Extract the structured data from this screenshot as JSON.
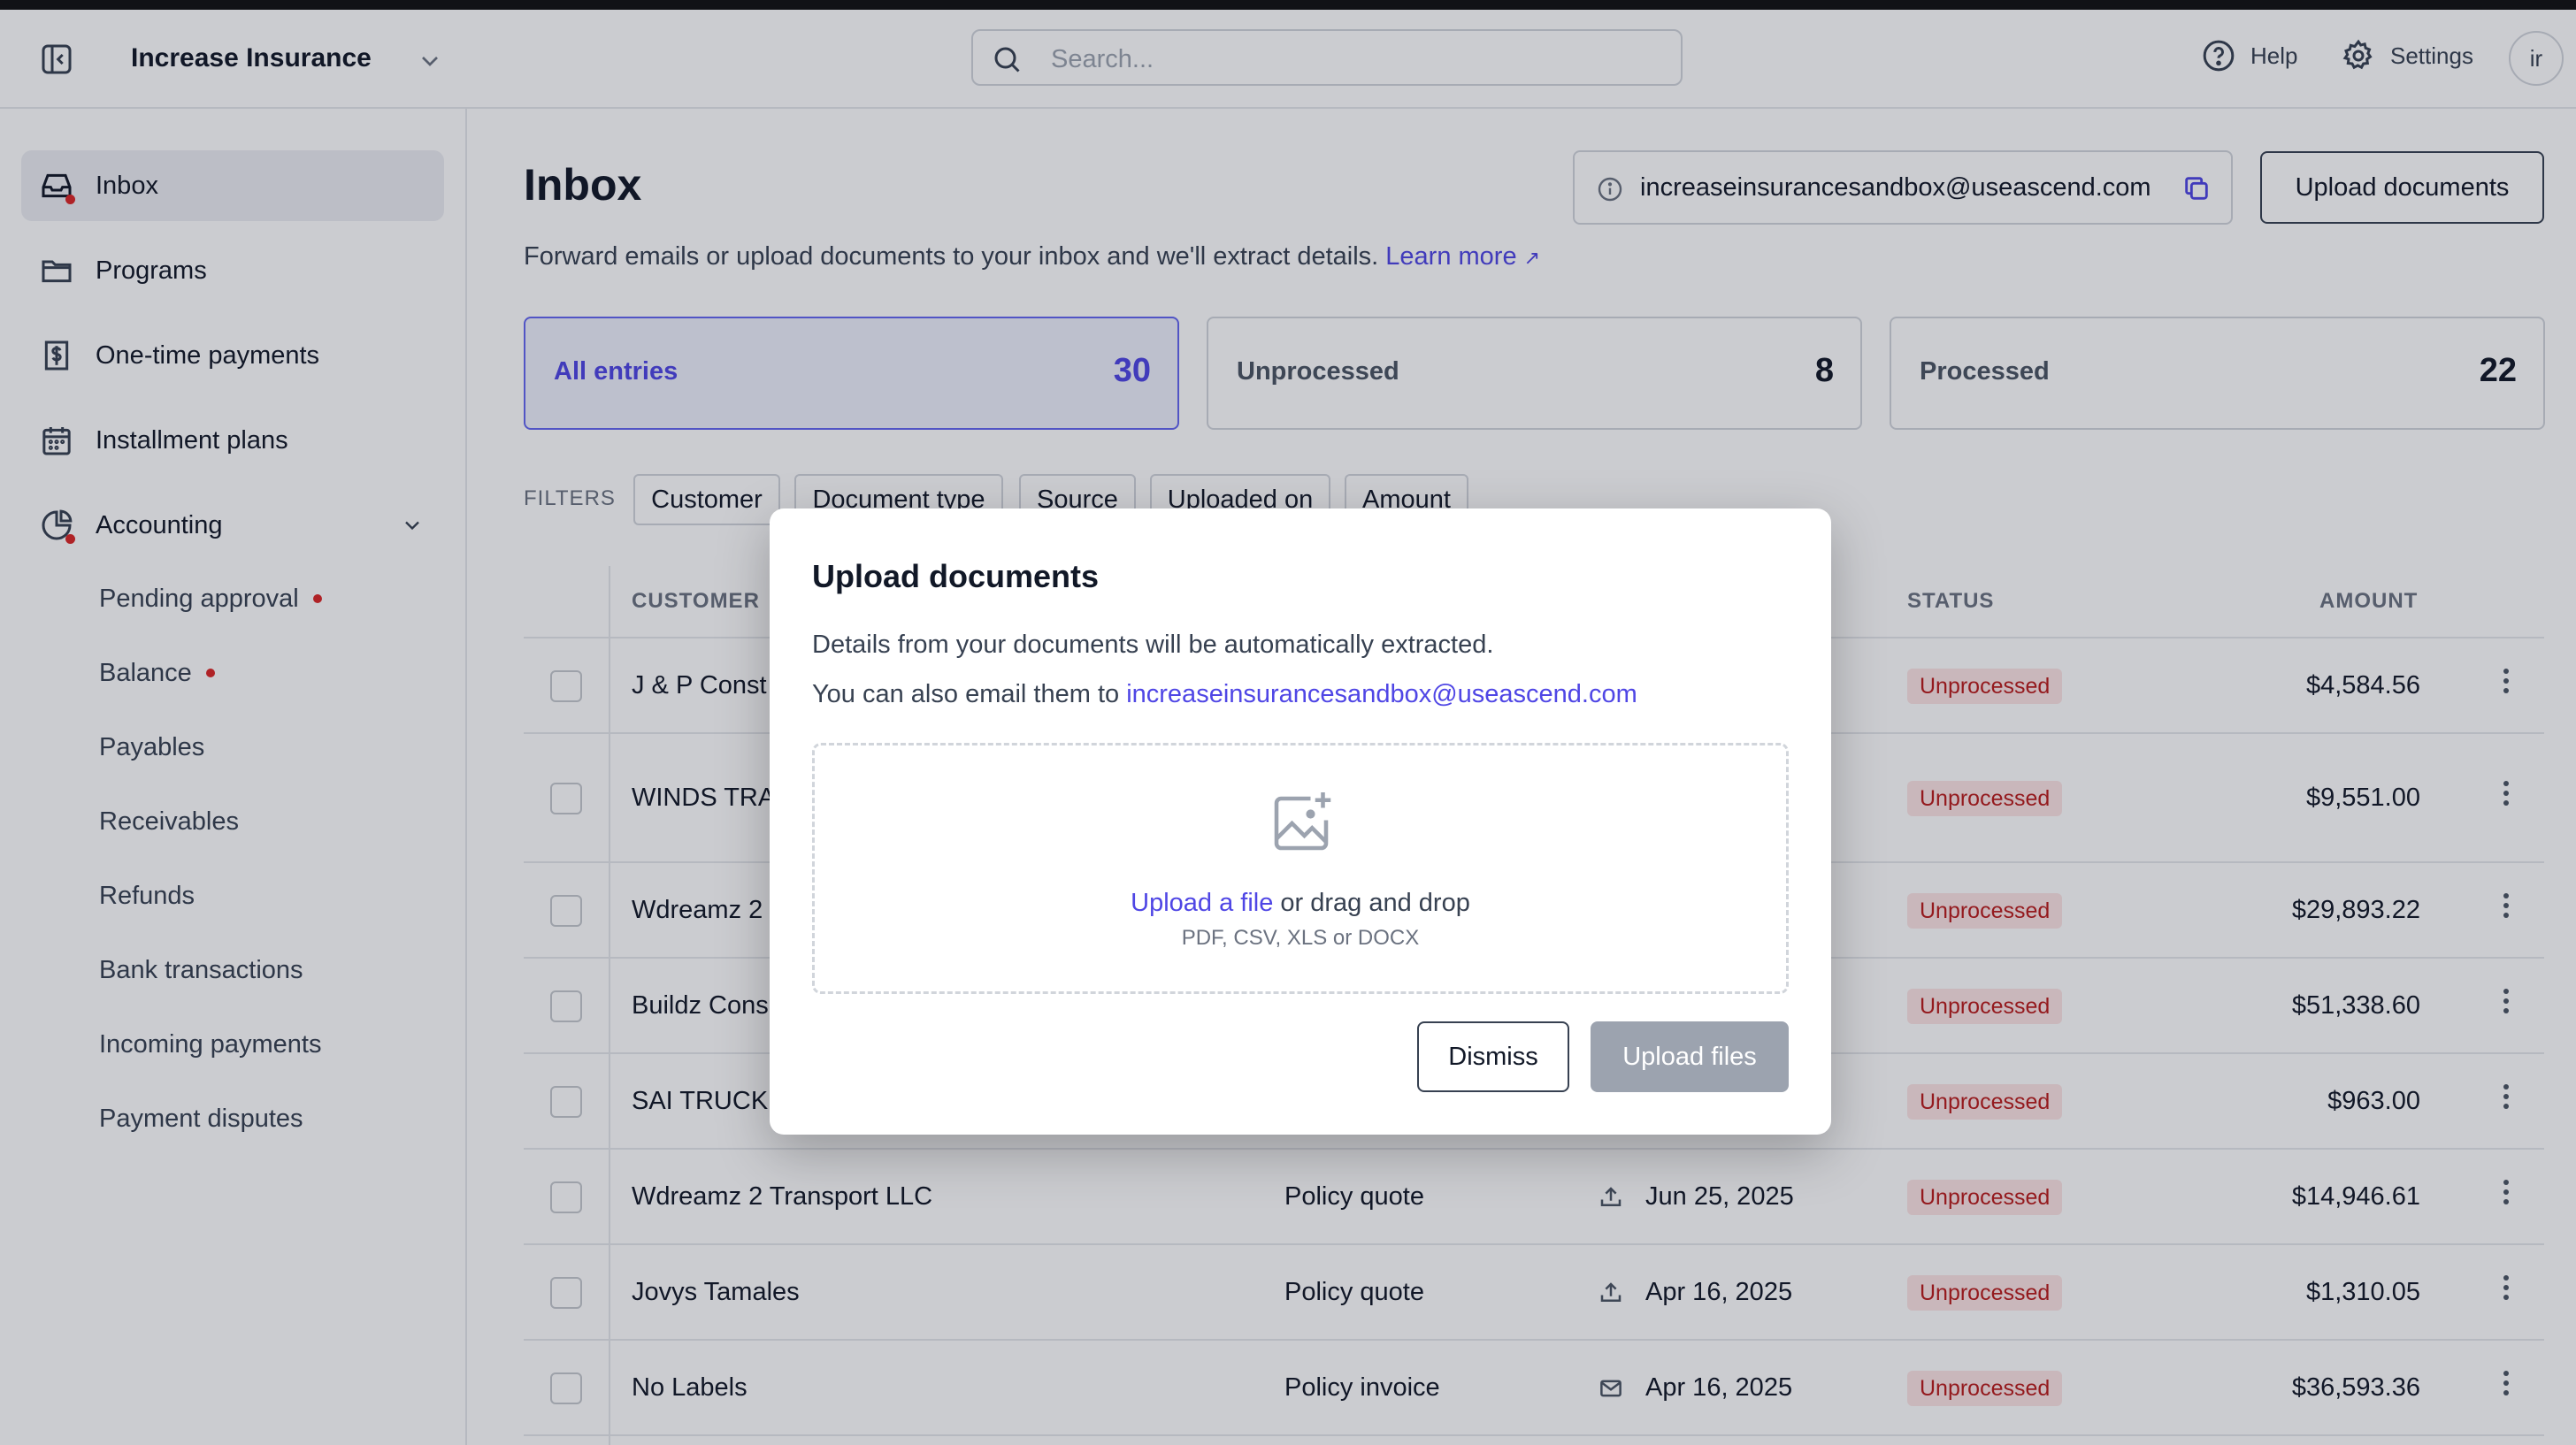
{
  "app": {
    "org_name": "Increase Insurance",
    "search_placeholder": "Search...",
    "help_label": "Help",
    "settings_label": "Settings",
    "avatar_initials": "ir"
  },
  "sidebar": {
    "inbox": "Inbox",
    "programs": "Programs",
    "one_time_payments": "One-time payments",
    "installment_plans": "Installment plans",
    "accounting": "Accounting",
    "sub_items": [
      "Pending approval",
      "Balance",
      "Payables",
      "Receivables",
      "Refunds",
      "Bank transactions",
      "Incoming payments",
      "Payment disputes"
    ]
  },
  "page": {
    "title": "Inbox",
    "email": "increaseinsurancesandbox@useascend.com",
    "upload_button": "Upload documents",
    "subtitle": "Forward emails or upload documents to your inbox and we'll extract details.",
    "learn_more": "Learn more"
  },
  "tabs": [
    {
      "label": "All entries",
      "count": "30"
    },
    {
      "label": "Unprocessed",
      "count": "8"
    },
    {
      "label": "Processed",
      "count": "22"
    }
  ],
  "filters": {
    "label": "FILTERS",
    "chips": [
      "Customer",
      "Document type",
      "Source",
      "Uploaded on",
      "Amount"
    ]
  },
  "table": {
    "headers": {
      "customer": "CUSTOMER",
      "status": "STATUS",
      "amount": "AMOUNT"
    },
    "rows": [
      {
        "customer": "J & P Const",
        "doc_type": "",
        "source": "",
        "date": "",
        "status": "Unprocessed",
        "amount": "$4,584.56"
      },
      {
        "customer": "WINDS TRA",
        "doc_type": "",
        "source": "",
        "date": "",
        "status": "Unprocessed",
        "amount": "$9,551.00"
      },
      {
        "customer": "Wdreamz 2",
        "doc_type": "",
        "source": "",
        "date": "",
        "status": "Unprocessed",
        "amount": "$29,893.22"
      },
      {
        "customer": "Buildz Cons",
        "doc_type": "",
        "source": "",
        "date": "",
        "status": "Unprocessed",
        "amount": "$51,338.60"
      },
      {
        "customer": "SAI TRUCK",
        "doc_type": "",
        "source": "",
        "date": "",
        "status": "Unprocessed",
        "amount": "$963.00"
      },
      {
        "customer": "Wdreamz 2 Transport LLC",
        "doc_type": "Policy quote",
        "source": "upload",
        "date": "Jun 25, 2025",
        "status": "Unprocessed",
        "amount": "$14,946.61"
      },
      {
        "customer": "Jovys Tamales",
        "doc_type": "Policy quote",
        "source": "upload",
        "date": "Apr 16, 2025",
        "status": "Unprocessed",
        "amount": "$1,310.05"
      },
      {
        "customer": "No Labels",
        "doc_type": "Policy invoice",
        "source": "email",
        "date": "Apr 16, 2025",
        "status": "Unprocessed",
        "amount": "$36,593.36"
      }
    ]
  },
  "modal": {
    "title": "Upload documents",
    "line1": "Details from your documents will be automatically extracted.",
    "line2_prefix": "You can also email them to",
    "email": "increaseinsurancesandbox@useascend.com",
    "upload_link": "Upload a file",
    "drag_text": "or drag and drop",
    "formats": "PDF, CSV, XLS or DOCX",
    "dismiss": "Dismiss",
    "upload_files": "Upload files"
  },
  "colors": {
    "accent": "#4f46e5",
    "status_bg": "#fde4e4",
    "status_text": "#b91c1c",
    "disabled_button": "#9ca3af",
    "notification_dot": "#dc2626"
  },
  "icons": {
    "sidebar_toggle": "sidebar-toggle-icon",
    "search": "search-icon",
    "help": "help-circle-icon",
    "settings": "gear-icon",
    "upload_source": "upload-icon",
    "email_source": "mail-icon",
    "image_add": "image-plus-icon"
  }
}
